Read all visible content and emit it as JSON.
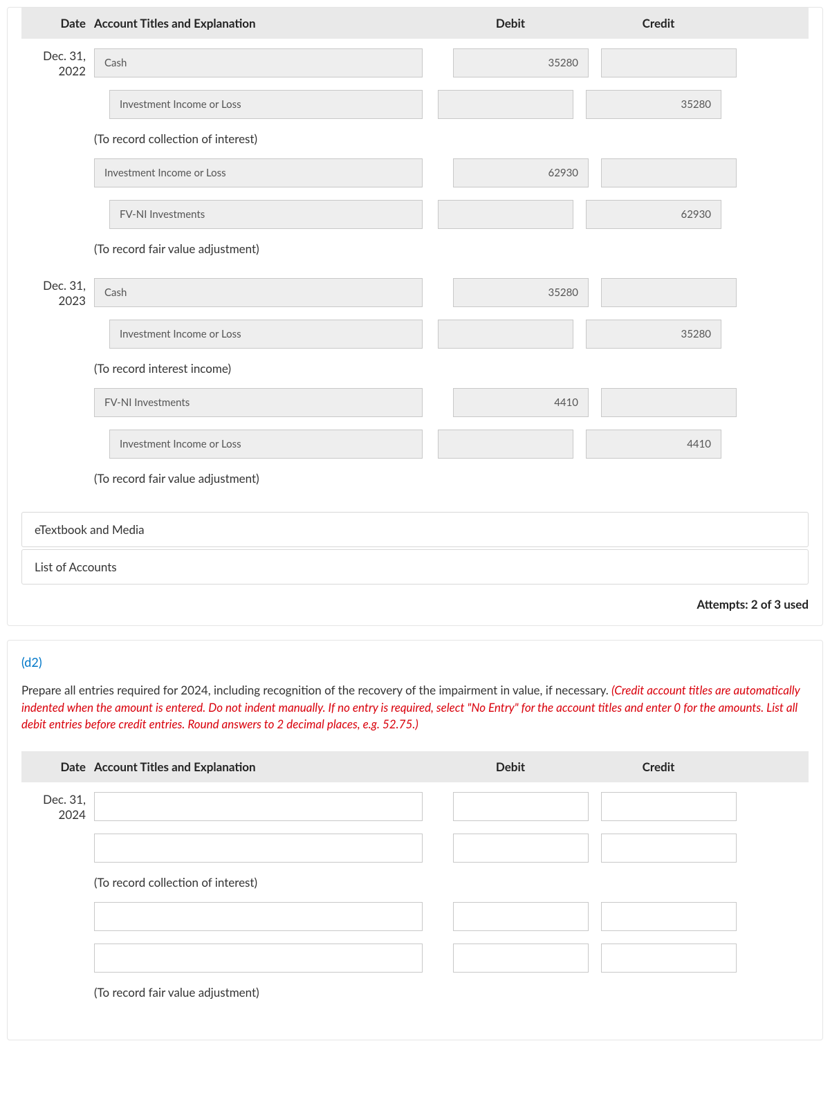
{
  "headers": {
    "date": "Date",
    "account": "Account Titles and Explanation",
    "debit": "Debit",
    "credit": "Credit"
  },
  "section1": {
    "blocks": [
      {
        "date": "Dec. 31, 2022",
        "rows": [
          {
            "account": "Cash",
            "indent": false,
            "debit": "35280",
            "credit": ""
          },
          {
            "account": "Investment Income or Loss",
            "indent": true,
            "debit": "",
            "credit": "35280"
          },
          {
            "explain": "(To record collection of interest)"
          },
          {
            "account": "Investment Income or Loss",
            "indent": false,
            "debit": "62930",
            "credit": ""
          },
          {
            "account": "FV-NI Investments",
            "indent": true,
            "debit": "",
            "credit": "62930"
          },
          {
            "explain": "(To record fair value adjustment)"
          }
        ]
      },
      {
        "date": "Dec. 31, 2023",
        "rows": [
          {
            "account": "Cash",
            "indent": false,
            "debit": "35280",
            "credit": ""
          },
          {
            "account": "Investment Income or Loss",
            "indent": true,
            "debit": "",
            "credit": "35280"
          },
          {
            "explain": "(To record interest income)"
          },
          {
            "account": "FV-NI Investments",
            "indent": false,
            "debit": "4410",
            "credit": ""
          },
          {
            "account": "Investment Income or Loss",
            "indent": true,
            "debit": "",
            "credit": "4410"
          },
          {
            "explain": "(To record fair value adjustment)"
          }
        ]
      }
    ]
  },
  "resources": {
    "etextbook": "eTextbook and Media",
    "accounts": "List of Accounts"
  },
  "attempts": "Attempts: 2 of 3 used",
  "d2": {
    "label": "(d2)",
    "instruct_plain": "Prepare all entries required for 2024, including recognition of the recovery of the impairment in value, if necessary. ",
    "instruct_red": "(Credit account titles are automatically indented when the amount is entered. Do not indent manually. If no entry is required, select \"No Entry\" for the account titles and enter 0 for the amounts. List all debit entries before credit entries. Round answers to 2 decimal places, e.g. 52.75.)",
    "blocks": [
      {
        "date": "Dec. 31, 2024",
        "rows": [
          {
            "account": "",
            "indent": false,
            "blank": true,
            "debit": "",
            "credit": ""
          },
          {
            "account": "",
            "indent": false,
            "blank": true,
            "debit": "",
            "credit": ""
          },
          {
            "explain": "(To record collection of interest)"
          },
          {
            "account": "",
            "indent": false,
            "blank": true,
            "debit": "",
            "credit": ""
          },
          {
            "account": "",
            "indent": false,
            "blank": true,
            "debit": "",
            "credit": ""
          },
          {
            "explain": "(To record fair value adjustment)"
          }
        ]
      }
    ]
  }
}
